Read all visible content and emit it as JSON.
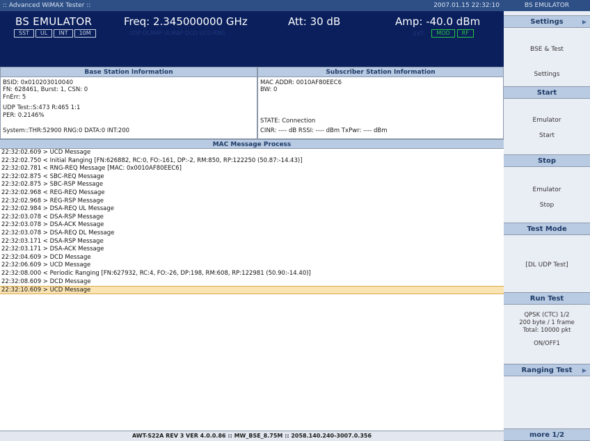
{
  "titlebar": {
    "app_name": ":: Advanced WiMAX Tester ::",
    "datetime": "2007.01.15 22:32:10"
  },
  "header": {
    "title": "BS EMULATOR",
    "freq": "Freq: 2.345000000 GHz",
    "att": "Att: 30 dB",
    "amp": "Amp: -40.0 dBm",
    "tabs": [
      "SST",
      "UL",
      "INT",
      "10M"
    ],
    "faint_text": "UDP  DLMAP  ULMAP  DCD  UCD  RNG",
    "right_faint": "EXT",
    "right_tabs": [
      "MOD",
      "RF"
    ]
  },
  "bs_info": {
    "title": "Base Station Information",
    "bsid": "BSID: 0x010203010040",
    "fn": "FN:  628461, Burst: 1, CSN: 0",
    "fnerr": "FnErr: 5",
    "udp": "UDP Test::S:473  R:465  1:1",
    "per": "PER: 0.2146%",
    "system": "System::THR:52900  RNG:0  DATA:0  INT:200"
  },
  "ss_info": {
    "title": "Subscriber Station Information",
    "mac": "MAC ADDR: 0010AF80EEC6",
    "bw": "BW: 0",
    "state": "STATE: Connection",
    "cinr": "CINR: ---- dB   RSSI: ---- dBm   TxPwr: ---- dBm"
  },
  "mmp": {
    "title": "MAC Message Process",
    "lines": [
      "22:32:02.609 > UCD Message",
      "22:32:02.750 < Initial Ranging [FN:626882, RC:0, FO:-161, DP:-2, RM:850, RP:122250 (50.87:-14.43)]",
      "22:32:02.781 < RNG-REQ Message [MAC: 0x0010AF80EEC6]",
      "22:32:02.875 < SBC-REQ Message",
      "22:32:02.875 > SBC-RSP Message",
      "22:32:02.968 < REG-REQ Message",
      "22:32:02.968 > REG-RSP Message",
      "22:32:02.984 > DSA-REQ UL Message",
      "22:32:03.078 < DSA-RSP Message",
      "22:32:03.078 > DSA-ACK Message",
      "22:32:03.078 > DSA-REQ DL Message",
      "22:32:03.171 < DSA-RSP Message",
      "22:32:03.171 > DSA-ACK Message",
      "22:32:04.609 > DCD Message",
      "22:32:06.609 > UCD Message",
      "22:32:08.000 < Periodic Ranging [FN:627932, RC:4, FO:-26, DP:198, RM:608, RP:122981 (50.90:-14.40)]",
      "22:32:08.609 > DCD Message",
      "22:32:10.609 > UCD Message"
    ],
    "selected_index": 17
  },
  "footer": {
    "text": "AWT-S22A REV 3 VER 4.0.0.86 :: MW_BSE_8.75M :: 2058.140.240-3007.0.356"
  },
  "sidebar": {
    "top": "BS EMULATOR",
    "settings": {
      "header": "Settings",
      "line1": "BSE & Test",
      "line2": "Settings"
    },
    "start": {
      "header": "Start",
      "line1": "Emulator",
      "line2": "Start"
    },
    "stop": {
      "header": "Stop",
      "line1": "Emulator",
      "line2": "Stop"
    },
    "test_mode": {
      "header": "Test Mode",
      "line1": "[DL UDP Test]"
    },
    "run_test": {
      "header": "Run Test",
      "line1": "QPSK (CTC) 1/2",
      "line2": "200 byte / 1 frame",
      "line3": "Total: 10000 pkt",
      "line4": "ON/OFF1"
    },
    "ranging": {
      "header": "Ranging Test"
    },
    "more": "more 1/2"
  },
  "colors": {
    "header_bg": "#0a1f5c",
    "titlebar_bg": "#2d4f86",
    "section_header": "#b9cbe3",
    "selected_row": "#fbe4b3",
    "indicator_green": "#27c93f"
  }
}
